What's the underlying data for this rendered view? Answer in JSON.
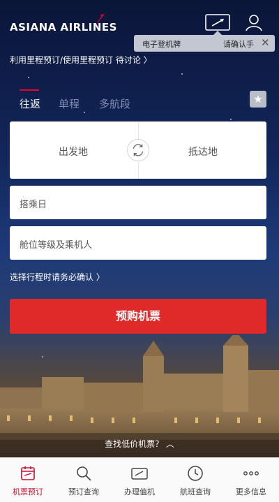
{
  "header": {
    "logo_text": "ASIANA AIRLINES",
    "brand_color": "#e4002b"
  },
  "tooltip": {
    "boarding_pass": "电子登机牌",
    "confirm_hint": "请确认手",
    "close_glyph": "✕"
  },
  "mileage_link": "利用里程预订/使用里程预订 待讨论 〉",
  "tabs": [
    {
      "label": "往返",
      "active": true
    },
    {
      "label": "单程",
      "active": false
    },
    {
      "label": "多航段",
      "active": false
    }
  ],
  "favorite_glyph": "★",
  "route": {
    "from_placeholder": "出发地",
    "to_placeholder": "抵达地"
  },
  "date_field": "搭乘日",
  "class_field": "舱位等级及乘机人",
  "itinerary_notice": "选择行程时请务必确认 〉",
  "book_button": "预购机票",
  "low_fare_link": "查找低价机票？ ︿",
  "bottom_nav": [
    {
      "label": "机票预订",
      "icon": "calendar-icon",
      "active": true
    },
    {
      "label": "预订查询",
      "icon": "search-icon",
      "active": false
    },
    {
      "label": "办理值机",
      "icon": "boarding-pass-icon",
      "active": false
    },
    {
      "label": "航班查询",
      "icon": "clock-icon",
      "active": false
    },
    {
      "label": "更多信息",
      "icon": "more-icon",
      "active": false
    }
  ]
}
